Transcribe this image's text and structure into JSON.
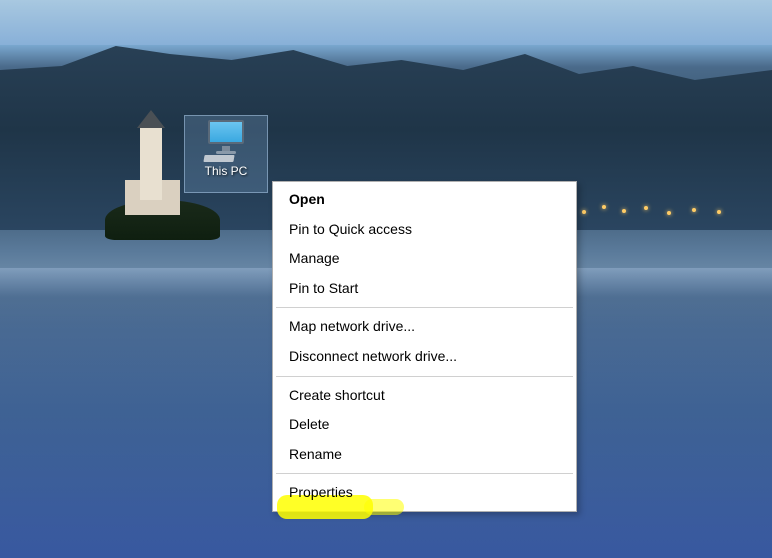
{
  "desktop_icon": {
    "label": "This PC"
  },
  "context_menu": {
    "items": [
      {
        "label": "Open",
        "bold": true
      },
      {
        "label": "Pin to Quick access",
        "bold": false
      },
      {
        "label": "Manage",
        "bold": false
      },
      {
        "label": "Pin to Start",
        "bold": false
      }
    ],
    "items_group2": [
      {
        "label": "Map network drive...",
        "bold": false
      },
      {
        "label": "Disconnect network drive...",
        "bold": false
      }
    ],
    "items_group3": [
      {
        "label": "Create shortcut",
        "bold": false
      },
      {
        "label": "Delete",
        "bold": false
      },
      {
        "label": "Rename",
        "bold": false
      }
    ],
    "items_group4": [
      {
        "label": "Properties",
        "bold": false,
        "highlighted": true
      }
    ]
  }
}
